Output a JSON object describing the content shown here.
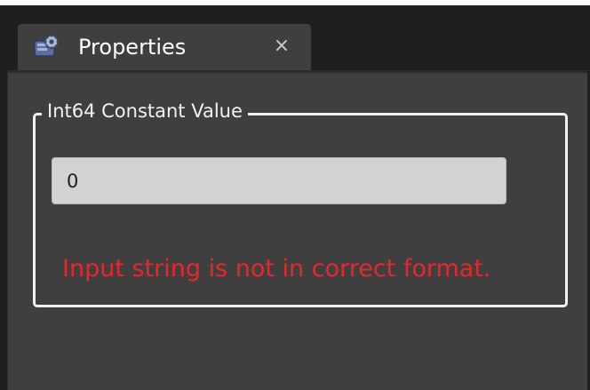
{
  "window": {
    "tab_title": "Properties",
    "tab_icon": "properties-gear-icon",
    "close_glyph": "×"
  },
  "group": {
    "title": "Int64 Constant Value",
    "input_value": "0",
    "error_message": "Input string is not in correct format."
  },
  "colors": {
    "error": "#e8262d",
    "panel": "#3f3f3f",
    "background": "#1f1f1f",
    "input": "#d2d2d2"
  }
}
